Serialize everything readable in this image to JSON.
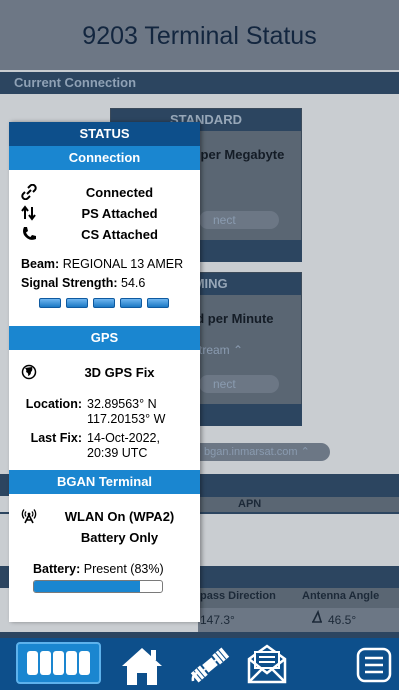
{
  "page": {
    "title": "9203 Terminal Status",
    "section_current": "Current Connection",
    "standard_label": "STANDARD",
    "standard_text": "d per Megabyte",
    "standard_pill": "nect",
    "roaming_label": "AMING",
    "roaming_text": "ed per Minute",
    "roaming_select": "tream",
    "roaming_pill": "nect",
    "apn_row": "bgan.inmarsat.com",
    "apn_header": "APN",
    "compass_header": "pass Direction",
    "antenna_header": "Antenna Angle",
    "compass_value": "147.3°",
    "antenna_value": "46.5°"
  },
  "drawer": {
    "title": "STATUS",
    "connection": {
      "header": "Connection",
      "status": "Connected",
      "ps": "PS Attached",
      "cs": "CS Attached",
      "beam_label": "Beam:",
      "beam_value": "REGIONAL 13 AMER",
      "signal_label": "Signal Strength:",
      "signal_value": "54.6",
      "signal_bars_filled": 5,
      "signal_bars_total": 5
    },
    "gps": {
      "header": "GPS",
      "fix": "3D GPS Fix",
      "location_label": "Location:",
      "location_lat": "32.89563° N",
      "location_lon": "117.20153° W",
      "last_fix_label": "Last Fix:",
      "last_fix_date": "14-Oct-2022,",
      "last_fix_time": "20:39 UTC"
    },
    "bgan": {
      "header": "BGAN Terminal",
      "wlan": "WLAN On (WPA2)",
      "power": "Battery Only",
      "battery_label": "Battery:",
      "battery_value": "Present (83%)",
      "battery_level": 0.83
    }
  },
  "tabbar": {
    "items": [
      {
        "name": "status",
        "icon": "signal-bars-icon"
      },
      {
        "name": "home",
        "icon": "home-icon"
      },
      {
        "name": "satellite",
        "icon": "satellite-icon"
      },
      {
        "name": "messages",
        "icon": "envelope-icon"
      },
      {
        "name": "menu",
        "icon": "menu-icon"
      }
    ]
  },
  "colors": {
    "primary": "#0d4f8b",
    "accent": "#1a86d0",
    "overlay": "#5a6673"
  }
}
